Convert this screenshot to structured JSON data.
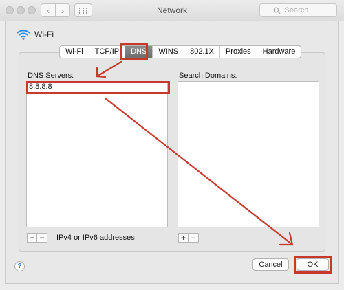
{
  "window": {
    "title": "Network"
  },
  "search": {
    "placeholder": "Search"
  },
  "interface": {
    "name": "Wi-Fi"
  },
  "tabs": [
    {
      "label": "Wi-Fi"
    },
    {
      "label": "TCP/IP"
    },
    {
      "label": "DNS",
      "active": true
    },
    {
      "label": "WINS"
    },
    {
      "label": "802.1X"
    },
    {
      "label": "Proxies"
    },
    {
      "label": "Hardware"
    }
  ],
  "dns": {
    "servers_label": "DNS Servers:",
    "servers": [
      "8.8.8.8"
    ],
    "hint": "IPv4 or IPv6 addresses"
  },
  "domains": {
    "label": "Search Domains:",
    "items": []
  },
  "buttons": {
    "cancel": "Cancel",
    "ok": "OK",
    "help": "?"
  },
  "annotation": {
    "color": "#c7392c"
  }
}
